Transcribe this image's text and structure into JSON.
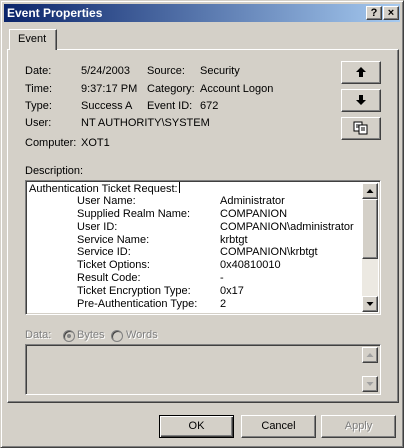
{
  "window": {
    "title": "Event Properties",
    "help_glyph": "?",
    "close_glyph": "×"
  },
  "tab": {
    "label": "Event"
  },
  "fields": {
    "date_label": "Date:",
    "date_value": "5/24/2003",
    "source_label": "Source:",
    "source_value": "Security",
    "time_label": "Time:",
    "time_value": "9:37:17 PM",
    "category_label": "Category:",
    "category_value": "Account Logon",
    "type_label": "Type:",
    "type_value": "Success A",
    "event_id_label": "Event ID:",
    "event_id_value": "672",
    "user_label": "User:",
    "user_value": "NT AUTHORITY\\SYSTEM",
    "computer_label": "Computer:",
    "computer_value": "XOT1"
  },
  "description": {
    "label": "Description:",
    "heading": "Authentication Ticket Request:",
    "rows": [
      {
        "key": "User Name:",
        "value": "Administrator"
      },
      {
        "key": "Supplied Realm Name:",
        "value": "COMPANION"
      },
      {
        "key": "User ID:",
        "value": "COMPANION\\administrator"
      },
      {
        "key": "Service Name:",
        "value": "krbtgt"
      },
      {
        "key": "Service ID:",
        "value": "COMPANION\\krbtgt"
      },
      {
        "key": "Ticket Options:",
        "value": "0x40810010"
      },
      {
        "key": "Result Code:",
        "value": "-"
      },
      {
        "key": "Ticket Encryption Type:",
        "value": "0x17"
      },
      {
        "key": "Pre-Authentication Type:",
        "value": "2"
      }
    ]
  },
  "data_section": {
    "label": "Data:",
    "bytes_label": "Bytes",
    "words_label": "Words",
    "selected": "Bytes"
  },
  "buttons": {
    "ok": "OK",
    "cancel": "Cancel",
    "apply": "Apply"
  },
  "icons": {
    "up": "up-arrow-icon",
    "down": "down-arrow-icon",
    "copy": "copy-icon"
  }
}
